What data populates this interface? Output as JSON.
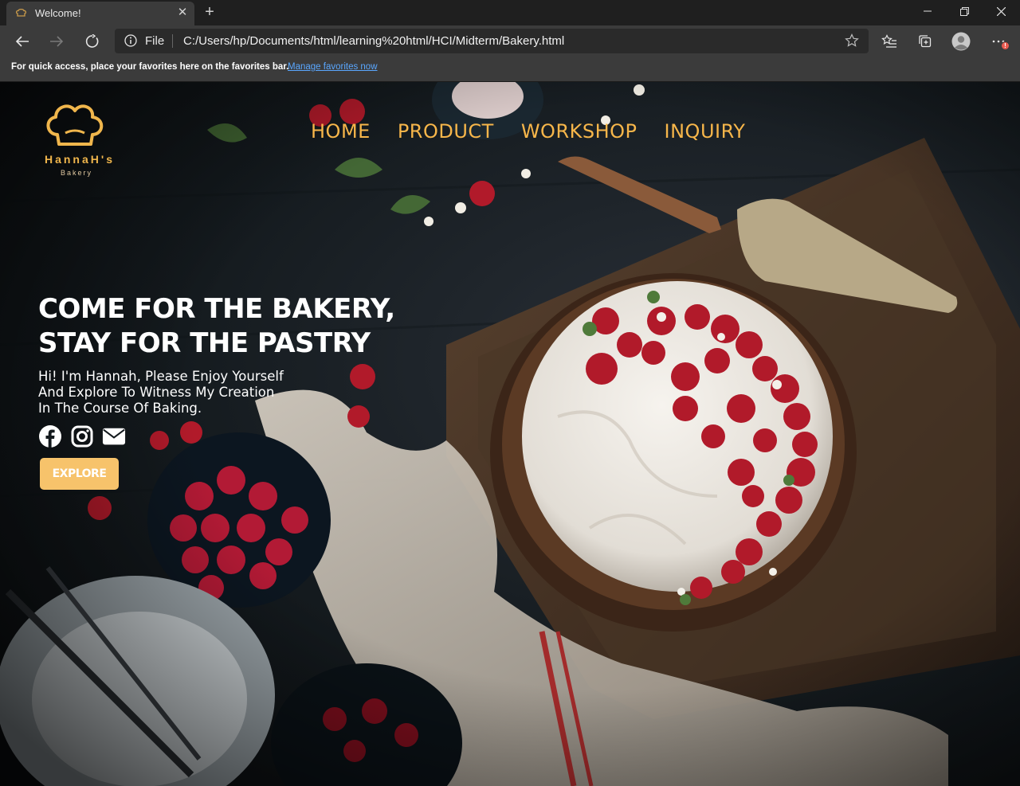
{
  "browser": {
    "tab": {
      "title": "Welcome!",
      "favicon": "chef-hat-icon"
    },
    "address": {
      "scheme": "File",
      "url": "C:/Users/hp/Documents/html/learning%20html/HCI/Midterm/Bakery.html"
    },
    "favorites_bar": {
      "message": "For quick access, place your favorites here on the favorites bar.",
      "link": "Manage favorites now"
    },
    "notification_badge": "!"
  },
  "site": {
    "logo": {
      "name": "HannaH's",
      "subtitle": "Bakery",
      "color": "#f0b64c"
    },
    "nav": [
      "HOME",
      "PRODUCT",
      "WORKSHOP",
      "INQUIRY"
    ],
    "nav_color": "#f7b64a",
    "hero": {
      "headline_line1": "COME FOR THE BAKERY,",
      "headline_line2": "STAY FOR THE PASTRY",
      "sub_line1": "Hi! I'm Hannah, Please Enjoy Yourself",
      "sub_line2": "And Explore To Witness My Creation",
      "sub_line3": "In The Course Of Baking.",
      "socials": [
        "facebook-icon",
        "instagram-icon",
        "envelope-icon"
      ],
      "cta": "EXPLORE",
      "cta_color": "#f7c36b"
    }
  }
}
